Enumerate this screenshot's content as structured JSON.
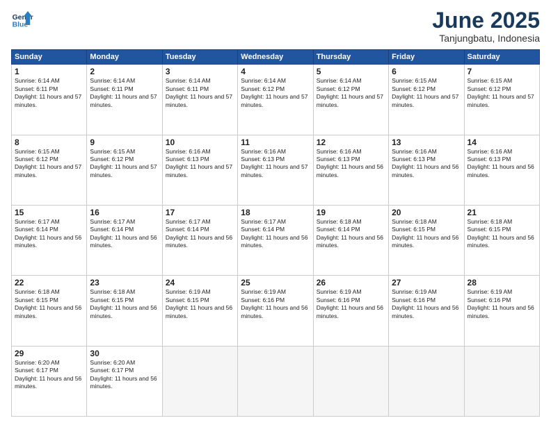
{
  "header": {
    "logo_line1": "General",
    "logo_line2": "Blue",
    "month_title": "June 2025",
    "location": "Tanjungbatu, Indonesia"
  },
  "days_of_week": [
    "Sunday",
    "Monday",
    "Tuesday",
    "Wednesday",
    "Thursday",
    "Friday",
    "Saturday"
  ],
  "weeks": [
    [
      {
        "day": "1",
        "sunrise": "6:14 AM",
        "sunset": "6:11 PM",
        "daylight": "11 hours and 57 minutes."
      },
      {
        "day": "2",
        "sunrise": "6:14 AM",
        "sunset": "6:11 PM",
        "daylight": "11 hours and 57 minutes."
      },
      {
        "day": "3",
        "sunrise": "6:14 AM",
        "sunset": "6:11 PM",
        "daylight": "11 hours and 57 minutes."
      },
      {
        "day": "4",
        "sunrise": "6:14 AM",
        "sunset": "6:12 PM",
        "daylight": "11 hours and 57 minutes."
      },
      {
        "day": "5",
        "sunrise": "6:14 AM",
        "sunset": "6:12 PM",
        "daylight": "11 hours and 57 minutes."
      },
      {
        "day": "6",
        "sunrise": "6:15 AM",
        "sunset": "6:12 PM",
        "daylight": "11 hours and 57 minutes."
      },
      {
        "day": "7",
        "sunrise": "6:15 AM",
        "sunset": "6:12 PM",
        "daylight": "11 hours and 57 minutes."
      }
    ],
    [
      {
        "day": "8",
        "sunrise": "6:15 AM",
        "sunset": "6:12 PM",
        "daylight": "11 hours and 57 minutes."
      },
      {
        "day": "9",
        "sunrise": "6:15 AM",
        "sunset": "6:12 PM",
        "daylight": "11 hours and 57 minutes."
      },
      {
        "day": "10",
        "sunrise": "6:16 AM",
        "sunset": "6:13 PM",
        "daylight": "11 hours and 57 minutes."
      },
      {
        "day": "11",
        "sunrise": "6:16 AM",
        "sunset": "6:13 PM",
        "daylight": "11 hours and 57 minutes."
      },
      {
        "day": "12",
        "sunrise": "6:16 AM",
        "sunset": "6:13 PM",
        "daylight": "11 hours and 56 minutes."
      },
      {
        "day": "13",
        "sunrise": "6:16 AM",
        "sunset": "6:13 PM",
        "daylight": "11 hours and 56 minutes."
      },
      {
        "day": "14",
        "sunrise": "6:16 AM",
        "sunset": "6:13 PM",
        "daylight": "11 hours and 56 minutes."
      }
    ],
    [
      {
        "day": "15",
        "sunrise": "6:17 AM",
        "sunset": "6:14 PM",
        "daylight": "11 hours and 56 minutes."
      },
      {
        "day": "16",
        "sunrise": "6:17 AM",
        "sunset": "6:14 PM",
        "daylight": "11 hours and 56 minutes."
      },
      {
        "day": "17",
        "sunrise": "6:17 AM",
        "sunset": "6:14 PM",
        "daylight": "11 hours and 56 minutes."
      },
      {
        "day": "18",
        "sunrise": "6:17 AM",
        "sunset": "6:14 PM",
        "daylight": "11 hours and 56 minutes."
      },
      {
        "day": "19",
        "sunrise": "6:18 AM",
        "sunset": "6:14 PM",
        "daylight": "11 hours and 56 minutes."
      },
      {
        "day": "20",
        "sunrise": "6:18 AM",
        "sunset": "6:15 PM",
        "daylight": "11 hours and 56 minutes."
      },
      {
        "day": "21",
        "sunrise": "6:18 AM",
        "sunset": "6:15 PM",
        "daylight": "11 hours and 56 minutes."
      }
    ],
    [
      {
        "day": "22",
        "sunrise": "6:18 AM",
        "sunset": "6:15 PM",
        "daylight": "11 hours and 56 minutes."
      },
      {
        "day": "23",
        "sunrise": "6:18 AM",
        "sunset": "6:15 PM",
        "daylight": "11 hours and 56 minutes."
      },
      {
        "day": "24",
        "sunrise": "6:19 AM",
        "sunset": "6:15 PM",
        "daylight": "11 hours and 56 minutes."
      },
      {
        "day": "25",
        "sunrise": "6:19 AM",
        "sunset": "6:16 PM",
        "daylight": "11 hours and 56 minutes."
      },
      {
        "day": "26",
        "sunrise": "6:19 AM",
        "sunset": "6:16 PM",
        "daylight": "11 hours and 56 minutes."
      },
      {
        "day": "27",
        "sunrise": "6:19 AM",
        "sunset": "6:16 PM",
        "daylight": "11 hours and 56 minutes."
      },
      {
        "day": "28",
        "sunrise": "6:19 AM",
        "sunset": "6:16 PM",
        "daylight": "11 hours and 56 minutes."
      }
    ],
    [
      {
        "day": "29",
        "sunrise": "6:20 AM",
        "sunset": "6:17 PM",
        "daylight": "11 hours and 56 minutes."
      },
      {
        "day": "30",
        "sunrise": "6:20 AM",
        "sunset": "6:17 PM",
        "daylight": "11 hours and 56 minutes."
      },
      null,
      null,
      null,
      null,
      null
    ]
  ]
}
